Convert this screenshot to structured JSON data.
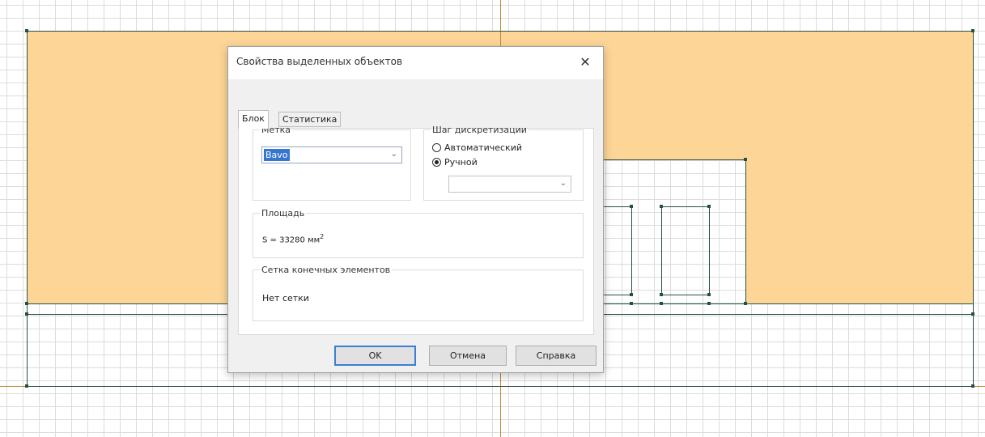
{
  "dialog": {
    "title": "Свойства выделенных объектов",
    "close_glyph": "✕",
    "tabs": [
      {
        "label": "Блок",
        "active": true
      },
      {
        "label": "Статистика",
        "active": false
      }
    ],
    "label_group": {
      "legend": "Метка",
      "selected_value": "Bavo"
    },
    "step_group": {
      "legend": "Шаг дискретизации",
      "options": [
        {
          "label": "Автоматический",
          "selected": false
        },
        {
          "label": "Ручной",
          "selected": true
        }
      ],
      "manual_value": ""
    },
    "area_group": {
      "legend": "Площадь",
      "prefix": "S = 33280 мм",
      "superscript": "2"
    },
    "mesh_group": {
      "legend": "Сетка конечных элементов",
      "value": "Нет сетки"
    },
    "buttons": {
      "ok": "OK",
      "cancel": "Отмена",
      "help": "Справка"
    }
  },
  "colors": {
    "selected_region": "#fcd597",
    "geometry_edges": "#27513f",
    "axis": "#c08a3a",
    "default_button_border": "#3c7fd1"
  }
}
